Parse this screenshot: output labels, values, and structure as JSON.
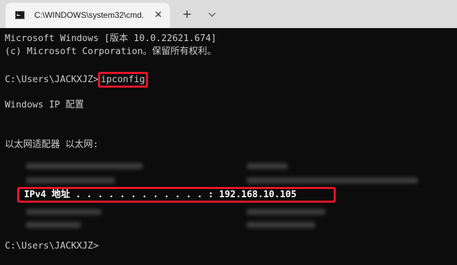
{
  "window": {
    "tab_title": "C:\\WINDOWS\\system32\\cmd.",
    "tab_icon": "terminal-icon",
    "close_glyph": "✕",
    "new_tab_glyph": "+",
    "dropdown_icon": "chevron-down-icon",
    "titlebar_color": "#dcdcdc",
    "tab_color": "#f3f3f3"
  },
  "terminal": {
    "background": "#0c0c0c",
    "foreground": "#cccccc",
    "highlight_color": "#e8152a",
    "lines": {
      "header1": "Microsoft Windows [版本 10.0.22621.674]",
      "header2": "(c) Microsoft Corporation。保留所有权利。",
      "prompt1": "C:\\Users\\JACKXJZ>",
      "command": "ipconfig",
      "ip_config_title": "Windows IP 配置",
      "adapter_title": "以太网适配器 以太网:",
      "ipv4_label": "IPv4 地址 . . . . . . . . . . . . : 192.168.10.105",
      "prompt2": "C:\\Users\\JACKXJZ>"
    }
  }
}
